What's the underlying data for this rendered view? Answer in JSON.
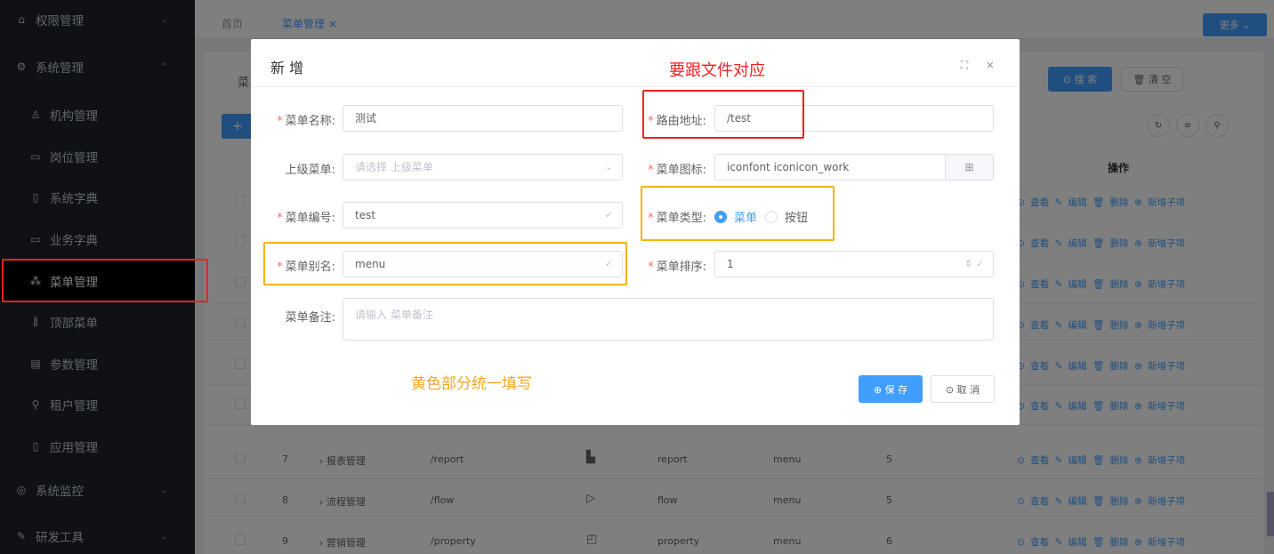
{
  "sidebar": {
    "items": [
      {
        "label": "权限管理",
        "icon": "lock-icon",
        "glyph": "⌂",
        "arrow": "⌄"
      },
      {
        "label": "系统管理",
        "icon": "gear-icon",
        "glyph": "⚙",
        "arrow": "⌃"
      },
      {
        "label": "机构管理",
        "icon": "org-icon",
        "glyph": "♙"
      },
      {
        "label": "岗位管理",
        "icon": "message-icon",
        "glyph": "▭"
      },
      {
        "label": "系统字典",
        "icon": "book-icon",
        "glyph": "▯"
      },
      {
        "label": "业务字典",
        "icon": "notebook-icon",
        "glyph": "▭"
      },
      {
        "label": "菜单管理",
        "icon": "tree-icon",
        "glyph": "⁂"
      },
      {
        "label": "顶部菜单",
        "icon": "columns-icon",
        "glyph": "⫼"
      },
      {
        "label": "参数管理",
        "icon": "list-icon",
        "glyph": "▤"
      },
      {
        "label": "租户管理",
        "icon": "key-icon",
        "glyph": "⚲"
      },
      {
        "label": "应用管理",
        "icon": "phone-icon",
        "glyph": "▯"
      },
      {
        "label": "系统监控",
        "icon": "shield-icon",
        "glyph": "◎",
        "arrow": "⌄"
      },
      {
        "label": "研发工具",
        "icon": "tool-icon",
        "glyph": "✎",
        "arrow": "⌄"
      }
    ]
  },
  "tabs": [
    {
      "label": "首页"
    },
    {
      "label": "菜单管理 ×"
    }
  ],
  "top_more": "更多 ⌄",
  "search": {
    "search_label": "⊙ 搜 索",
    "clear_label": "🗑 清 空",
    "trunc_label": "菜"
  },
  "table": {
    "ops_header": "操作",
    "ops_text": "⊙ 查看 ✎ 编辑 🗑 删除 ⊕ 新增子项",
    "rows": [
      {
        "no": "7",
        "name": "› 报表管理",
        "path": "/report",
        "icon_glyph": "▙",
        "code": "report",
        "alias": "menu",
        "sort": "5"
      },
      {
        "no": "8",
        "name": "› 流程管理",
        "path": "/flow",
        "icon_glyph": "▷",
        "code": "flow",
        "alias": "menu",
        "sort": "5"
      },
      {
        "no": "9",
        "name": "› 营销管理",
        "path": "/property",
        "icon_glyph": "◰",
        "code": "property",
        "alias": "menu",
        "sort": "6"
      }
    ]
  },
  "dialog": {
    "title": "新 增",
    "controls": "⛶ ×",
    "fields": {
      "name_label": "菜单名称:",
      "name_value": "测试",
      "route_label": "路由地址:",
      "route_value": "/test",
      "parent_label": "上级菜单:",
      "parent_placeholder": "请选择 上级菜单",
      "icon_label": "菜单图标:",
      "icon_value": "iconfont iconicon_work",
      "code_label": "菜单编号:",
      "code_value": "test",
      "type_label": "菜单类型:",
      "type_option_menu": "菜单",
      "type_option_button": "按钮",
      "alias_label": "菜单别名:",
      "alias_value": "menu",
      "sort_label": "菜单排序:",
      "sort_value": "1",
      "remark_label": "菜单备注:",
      "remark_placeholder": "请输入 菜单备注"
    },
    "save_label": "⊕ 保 存",
    "cancel_label": "⊙ 取 消"
  },
  "annotations": {
    "red_note": "要跟文件对应",
    "yellow_note": "黄色部分统一填写"
  },
  "colors": {
    "primary": "#409eff",
    "sidebar_bg": "#20222a",
    "annotation_red": "#ee2222",
    "annotation_yellow": "#f7b500"
  }
}
